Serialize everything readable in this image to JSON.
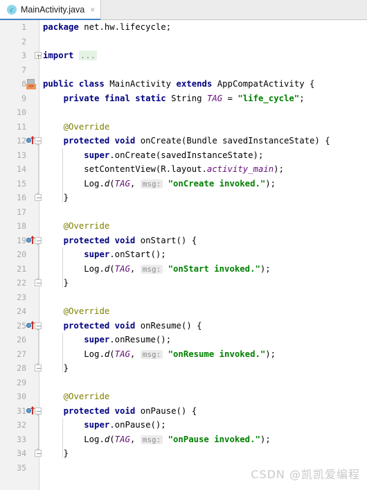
{
  "tab": {
    "label": "MainActivity.java",
    "icon": "c",
    "close": "×",
    "accent_color": "#4083c9"
  },
  "editor": {
    "language": "java",
    "lines": [
      {
        "num": "1",
        "indent": 0,
        "marker": "none",
        "fold": "none",
        "tokens": [
          {
            "t": "package ",
            "c": "kw"
          },
          {
            "t": "net.hw.lifecycle;",
            "c": "plain"
          }
        ]
      },
      {
        "num": "2",
        "indent": 0,
        "marker": "none",
        "fold": "none",
        "tokens": []
      },
      {
        "num": "3",
        "indent": 0,
        "marker": "none",
        "fold": "plus",
        "tokens": [
          {
            "t": "import ",
            "c": "kw"
          },
          {
            "t": "...",
            "c": "folded"
          }
        ]
      },
      {
        "num": "7",
        "indent": 0,
        "marker": "none",
        "fold": "none",
        "tokens": []
      },
      {
        "num": "8",
        "indent": 0,
        "marker": "class",
        "fold": "none",
        "tokens": [
          {
            "t": "public class ",
            "c": "kw"
          },
          {
            "t": "MainActivity ",
            "c": "plain"
          },
          {
            "t": "extends ",
            "c": "kw"
          },
          {
            "t": "AppCompatActivity {",
            "c": "plain"
          }
        ]
      },
      {
        "num": "9",
        "indent": 1,
        "marker": "none",
        "fold": "none",
        "tokens": [
          {
            "t": "    ",
            "c": "plain"
          },
          {
            "t": "private final static ",
            "c": "kw"
          },
          {
            "t": "String ",
            "c": "plain"
          },
          {
            "t": "TAG",
            "c": "field"
          },
          {
            "t": " = ",
            "c": "plain"
          },
          {
            "t": "\"life_cycle\"",
            "c": "str"
          },
          {
            "t": ";",
            "c": "plain"
          }
        ]
      },
      {
        "num": "10",
        "indent": 0,
        "marker": "none",
        "fold": "none",
        "tokens": []
      },
      {
        "num": "11",
        "indent": 1,
        "marker": "none",
        "fold": "none",
        "tokens": [
          {
            "t": "    ",
            "c": "plain"
          },
          {
            "t": "@Override",
            "c": "anno"
          }
        ]
      },
      {
        "num": "12",
        "indent": 1,
        "marker": "override",
        "fold": "start",
        "tokens": [
          {
            "t": "    ",
            "c": "plain"
          },
          {
            "t": "protected void ",
            "c": "kw"
          },
          {
            "t": "onCreate(Bundle savedInstanceState) {",
            "c": "plain"
          }
        ]
      },
      {
        "num": "13",
        "indent": 2,
        "marker": "none",
        "fold": "rail",
        "tokens": [
          {
            "t": "        ",
            "c": "plain"
          },
          {
            "t": "super",
            "c": "kw"
          },
          {
            "t": ".onCreate(savedInstanceState);",
            "c": "plain"
          }
        ]
      },
      {
        "num": "14",
        "indent": 2,
        "marker": "none",
        "fold": "rail",
        "tokens": [
          {
            "t": "        ",
            "c": "plain"
          },
          {
            "t": "setContentView(R.layout.",
            "c": "plain"
          },
          {
            "t": "activity_main",
            "c": "field"
          },
          {
            "t": ");",
            "c": "plain"
          }
        ]
      },
      {
        "num": "15",
        "indent": 2,
        "marker": "none",
        "fold": "rail",
        "tokens": [
          {
            "t": "        ",
            "c": "plain"
          },
          {
            "t": "Log.",
            "c": "plain"
          },
          {
            "t": "d",
            "c": "method"
          },
          {
            "t": "(",
            "c": "plain"
          },
          {
            "t": "TAG",
            "c": "field"
          },
          {
            "t": ", ",
            "c": "plain"
          },
          {
            "t": "msg:",
            "c": "hint"
          },
          {
            "t": " ",
            "c": "plain"
          },
          {
            "t": "\"onCreate invoked.\"",
            "c": "str"
          },
          {
            "t": ");",
            "c": "plain"
          }
        ]
      },
      {
        "num": "16",
        "indent": 1,
        "marker": "none",
        "fold": "end",
        "tokens": [
          {
            "t": "    }",
            "c": "plain"
          }
        ]
      },
      {
        "num": "17",
        "indent": 0,
        "marker": "none",
        "fold": "none",
        "tokens": []
      },
      {
        "num": "18",
        "indent": 1,
        "marker": "none",
        "fold": "none",
        "tokens": [
          {
            "t": "    ",
            "c": "plain"
          },
          {
            "t": "@Override",
            "c": "anno"
          }
        ]
      },
      {
        "num": "19",
        "indent": 1,
        "marker": "override",
        "fold": "start",
        "tokens": [
          {
            "t": "    ",
            "c": "plain"
          },
          {
            "t": "protected void ",
            "c": "kw"
          },
          {
            "t": "onStart() {",
            "c": "plain"
          }
        ]
      },
      {
        "num": "20",
        "indent": 2,
        "marker": "none",
        "fold": "rail",
        "tokens": [
          {
            "t": "        ",
            "c": "plain"
          },
          {
            "t": "super",
            "c": "kw"
          },
          {
            "t": ".onStart();",
            "c": "plain"
          }
        ]
      },
      {
        "num": "21",
        "indent": 2,
        "marker": "none",
        "fold": "rail",
        "tokens": [
          {
            "t": "        ",
            "c": "plain"
          },
          {
            "t": "Log.",
            "c": "plain"
          },
          {
            "t": "d",
            "c": "method"
          },
          {
            "t": "(",
            "c": "plain"
          },
          {
            "t": "TAG",
            "c": "field"
          },
          {
            "t": ", ",
            "c": "plain"
          },
          {
            "t": "msg:",
            "c": "hint"
          },
          {
            "t": " ",
            "c": "plain"
          },
          {
            "t": "\"onStart invoked.\"",
            "c": "str"
          },
          {
            "t": ");",
            "c": "plain"
          }
        ]
      },
      {
        "num": "22",
        "indent": 1,
        "marker": "none",
        "fold": "end",
        "tokens": [
          {
            "t": "    }",
            "c": "plain"
          }
        ]
      },
      {
        "num": "23",
        "indent": 0,
        "marker": "none",
        "fold": "none",
        "tokens": []
      },
      {
        "num": "24",
        "indent": 1,
        "marker": "none",
        "fold": "none",
        "tokens": [
          {
            "t": "    ",
            "c": "plain"
          },
          {
            "t": "@Override",
            "c": "anno"
          }
        ]
      },
      {
        "num": "25",
        "indent": 1,
        "marker": "override",
        "fold": "start",
        "tokens": [
          {
            "t": "    ",
            "c": "plain"
          },
          {
            "t": "protected void ",
            "c": "kw"
          },
          {
            "t": "onResume() {",
            "c": "plain"
          }
        ]
      },
      {
        "num": "26",
        "indent": 2,
        "marker": "none",
        "fold": "rail",
        "tokens": [
          {
            "t": "        ",
            "c": "plain"
          },
          {
            "t": "super",
            "c": "kw"
          },
          {
            "t": ".onResume();",
            "c": "plain"
          }
        ]
      },
      {
        "num": "27",
        "indent": 2,
        "marker": "none",
        "fold": "rail",
        "tokens": [
          {
            "t": "        ",
            "c": "plain"
          },
          {
            "t": "Log.",
            "c": "plain"
          },
          {
            "t": "d",
            "c": "method"
          },
          {
            "t": "(",
            "c": "plain"
          },
          {
            "t": "TAG",
            "c": "field"
          },
          {
            "t": ", ",
            "c": "plain"
          },
          {
            "t": "msg:",
            "c": "hint"
          },
          {
            "t": " ",
            "c": "plain"
          },
          {
            "t": "\"onResume invoked.\"",
            "c": "str"
          },
          {
            "t": ");",
            "c": "plain"
          }
        ]
      },
      {
        "num": "28",
        "indent": 1,
        "marker": "none",
        "fold": "end",
        "tokens": [
          {
            "t": "    }",
            "c": "plain"
          }
        ]
      },
      {
        "num": "29",
        "indent": 0,
        "marker": "none",
        "fold": "none",
        "tokens": []
      },
      {
        "num": "30",
        "indent": 1,
        "marker": "none",
        "fold": "none",
        "tokens": [
          {
            "t": "    ",
            "c": "plain"
          },
          {
            "t": "@Override",
            "c": "anno"
          }
        ]
      },
      {
        "num": "31",
        "indent": 1,
        "marker": "override",
        "fold": "start",
        "tokens": [
          {
            "t": "    ",
            "c": "plain"
          },
          {
            "t": "protected void ",
            "c": "kw"
          },
          {
            "t": "onPause() {",
            "c": "plain"
          }
        ]
      },
      {
        "num": "32",
        "indent": 2,
        "marker": "none",
        "fold": "rail",
        "tokens": [
          {
            "t": "        ",
            "c": "plain"
          },
          {
            "t": "super",
            "c": "kw"
          },
          {
            "t": ".onPause();",
            "c": "plain"
          }
        ]
      },
      {
        "num": "33",
        "indent": 2,
        "marker": "none",
        "fold": "rail",
        "tokens": [
          {
            "t": "        ",
            "c": "plain"
          },
          {
            "t": "Log.",
            "c": "plain"
          },
          {
            "t": "d",
            "c": "method"
          },
          {
            "t": "(",
            "c": "plain"
          },
          {
            "t": "TAG",
            "c": "field"
          },
          {
            "t": ", ",
            "c": "plain"
          },
          {
            "t": "msg:",
            "c": "hint"
          },
          {
            "t": " ",
            "c": "plain"
          },
          {
            "t": "\"onPause invoked.\"",
            "c": "str"
          },
          {
            "t": ");",
            "c": "plain"
          }
        ]
      },
      {
        "num": "34",
        "indent": 1,
        "marker": "none",
        "fold": "end",
        "tokens": [
          {
            "t": "    }",
            "c": "plain"
          }
        ]
      },
      {
        "num": "35",
        "indent": 0,
        "marker": "none",
        "fold": "none",
        "tokens": []
      }
    ]
  },
  "watermark": {
    "text": "CSDN @凯凯爱编程"
  },
  "theme": {
    "keyword_color": "#000080",
    "string_color": "#008000",
    "annotation_color": "#808000",
    "field_color": "#660e7a",
    "gutter_bg": "#f2f2f2",
    "editor_bg": "#ffffff",
    "tabbar_bg": "#ececec"
  }
}
